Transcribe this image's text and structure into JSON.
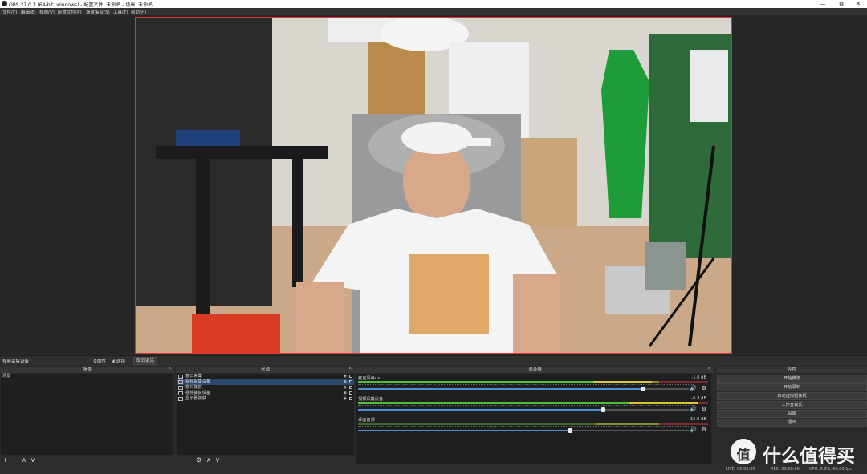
{
  "titlebar": {
    "title": "OBS 27.0.1 (64-bit, windows) - 配置文件: 未命名 - 场景: 未命名",
    "minimize": "—",
    "restore": "⧉",
    "close": "✕"
  },
  "menu": [
    "文件(F)",
    "编辑(E)",
    "视图(V)",
    "配置文件(P)",
    "场景集合(S)",
    "工具(T)",
    "帮助(H)"
  ],
  "context_bar": {
    "source": "视频采集设备",
    "properties": "属性",
    "filters": "滤镜",
    "deactivate": "取消激活"
  },
  "scenes": {
    "header": "场景",
    "items": [
      "场景"
    ]
  },
  "sources": {
    "header": "来源",
    "items": [
      "窗口采集",
      "视频采集设备",
      "窗口捕获",
      "视频捕获设备",
      "显示器捕获"
    ],
    "selected_index": 1
  },
  "mixer": {
    "header": "混音器",
    "channels": [
      {
        "name": "麦克风/Aux",
        "db": "-1.6 dB",
        "level": 0.84,
        "volume": 0.86
      },
      {
        "name": "视频采集设备",
        "db": "-6.3 dB",
        "level": 0.97,
        "volume": 0.74
      },
      {
        "name": "桌面音频",
        "db": "-15.0 dB",
        "level": 0.0,
        "volume": 0.64
      }
    ]
  },
  "controls": {
    "header": "控件",
    "buttons": [
      "开始推流",
      "开始录制",
      "启动虚拟摄像机",
      "工作室模式",
      "设置",
      "退出"
    ]
  },
  "dock_footer": {
    "add": "+",
    "remove": "−",
    "up": "∧",
    "down": "∨",
    "settings": "⚙"
  },
  "status": {
    "live": "LIVE: 00:00:00",
    "rec": "REC: 00:00:00",
    "perf": "CPU: 0.8%, 60.00 fps"
  },
  "watermark": {
    "logo": "值",
    "text": "什么值得买"
  },
  "colors": {
    "preview_border": "#dd3333",
    "selection": "#2c4a6e",
    "slider": "#4a8fd6"
  }
}
